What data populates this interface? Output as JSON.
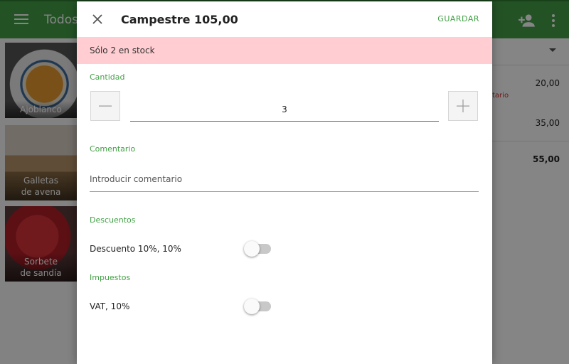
{
  "app": {
    "title": "Todos"
  },
  "tiles": [
    {
      "label": "Ajoblanco"
    },
    {
      "label": "Galletas\nde avena"
    },
    {
      "label": "Sorbete\nde sandía"
    }
  ],
  "order": {
    "amount_1": "20,00",
    "note": "tario",
    "amount_2": "35,00",
    "total": "55,00"
  },
  "dialog": {
    "title": "Campestre 105,00",
    "save_label": "GUARDAR",
    "close_icon": "close-icon",
    "stock_message": "Sólo 2 en stock",
    "quantity": {
      "label": "Cantidad",
      "value": "3"
    },
    "comment": {
      "label": "Comentario",
      "placeholder": "Introducir comentario"
    },
    "discounts": {
      "label": "Descuentos",
      "item_label": "Descuento 10%, 10%",
      "enabled": false
    },
    "taxes": {
      "label": "Impuestos",
      "item_label": "VAT, 10%",
      "enabled": false
    }
  },
  "colors": {
    "accent": "#43a047",
    "error": "#d32f2f",
    "stock_banner": "#ffcdd2"
  }
}
